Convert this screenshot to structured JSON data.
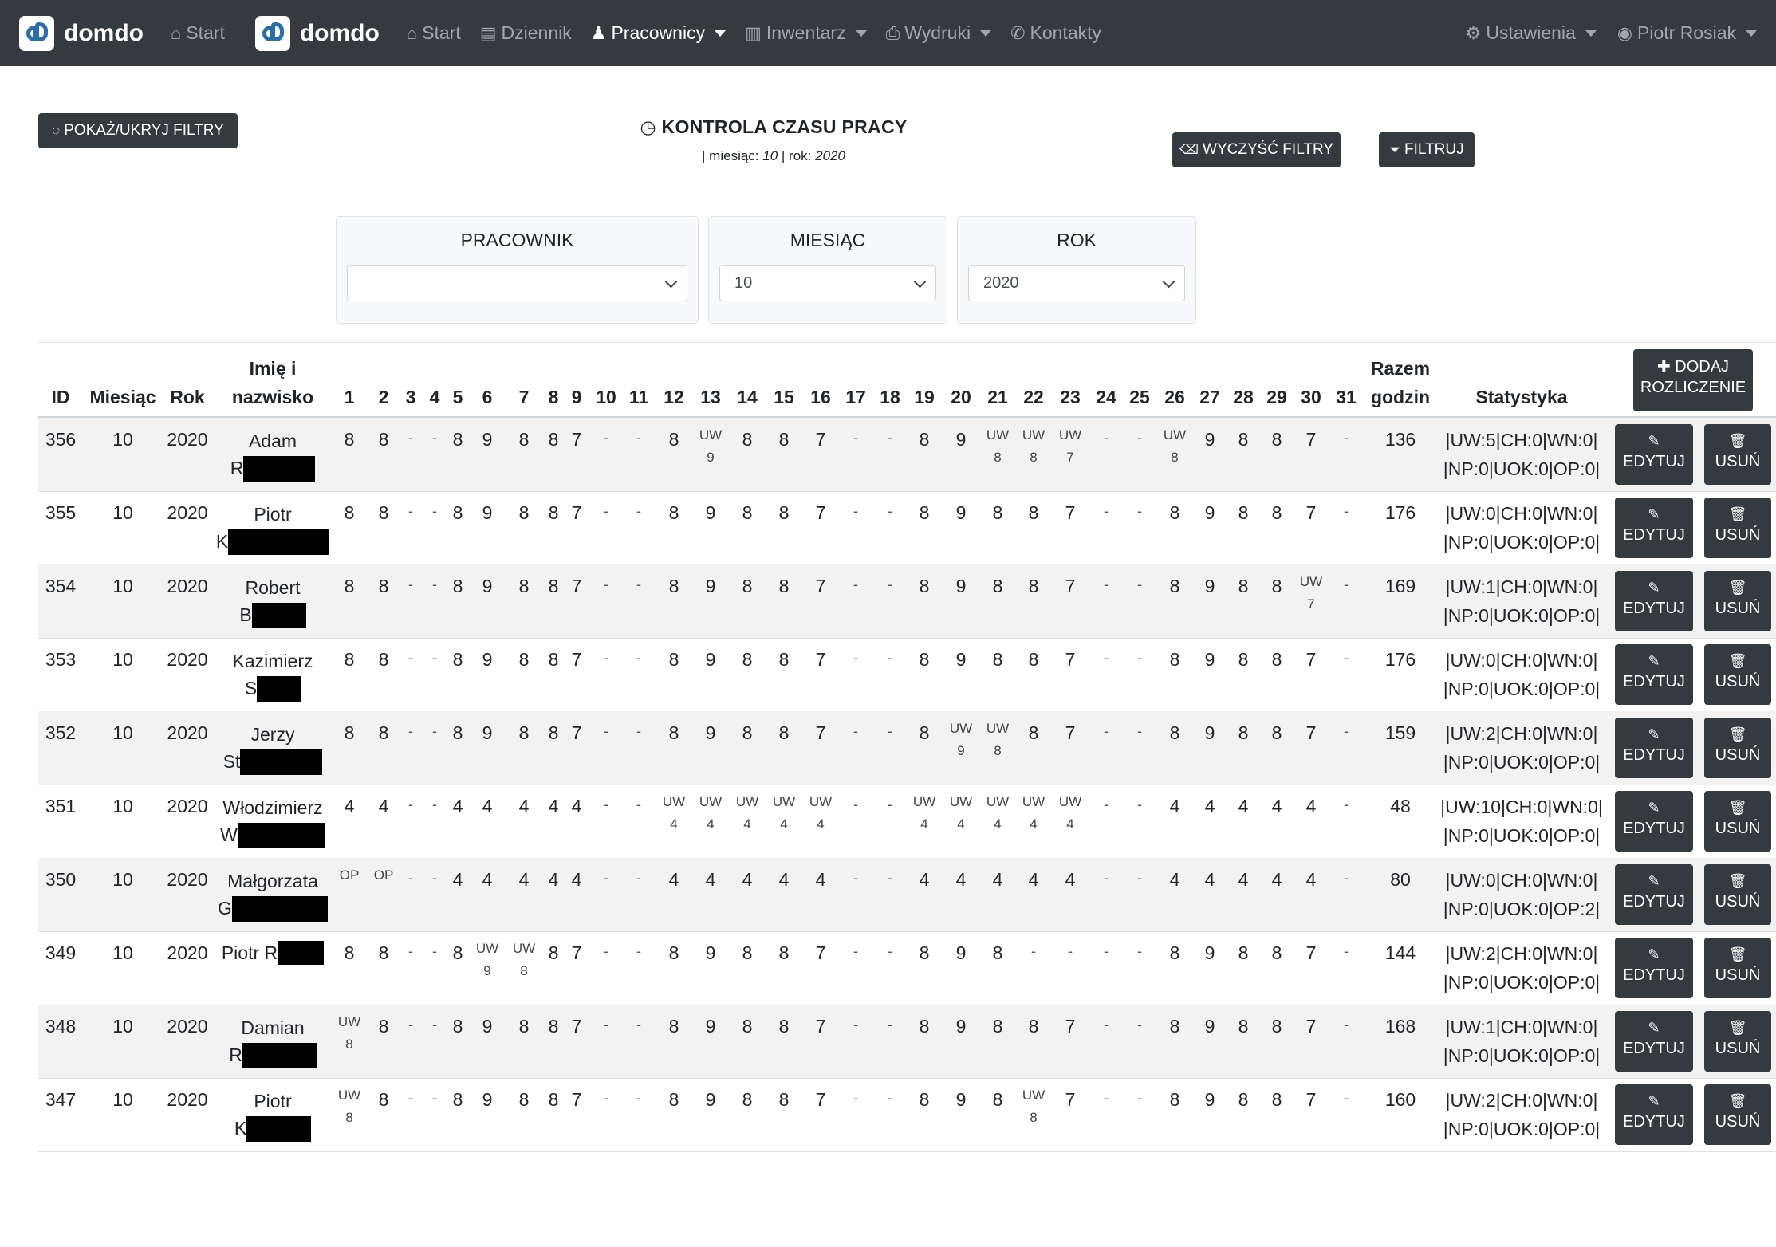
{
  "nav": {
    "brand": "domdo",
    "start": "Start",
    "dziennik": "Dziennik",
    "pracownicy": "Pracownicy",
    "inwentarz": "Inwentarz",
    "wydruki": "Wydruki",
    "kontakty": "Kontakty",
    "ustawienia": "Ustawienia",
    "user": "Piotr Rosiak"
  },
  "toolbar": {
    "toggle_filters": "POKAŻ/UKRYJ FILTRY",
    "clear_filters": "WYCZYŚĆ FILTRY",
    "filter": "FILTRUJ"
  },
  "page": {
    "title": "KONTROLA CZASU PRACY",
    "sub_prefix": "| miesiąc: ",
    "month": "10",
    "sub_mid": " | rok: ",
    "year": "2020"
  },
  "filters": {
    "employee_label": "PRACOWNIK",
    "employee_value": "",
    "month_label": "MIESIĄC",
    "month_value": "10",
    "year_label": "ROK",
    "year_value": "2020"
  },
  "table": {
    "headers": {
      "id": "ID",
      "month": "Miesiąc",
      "year": "Rok",
      "name_line1": "Imię i",
      "name_line2": "nazwisko",
      "total_line1": "Razem",
      "total_line2": "godzin",
      "stats": "Statystyka",
      "add_line1": "DODAJ",
      "add_line2": "ROZLICZENIE"
    },
    "days": [
      "1",
      "2",
      "3",
      "4",
      "5",
      "6",
      "7",
      "8",
      "9",
      "10",
      "11",
      "12",
      "13",
      "14",
      "15",
      "16",
      "17",
      "18",
      "19",
      "20",
      "21",
      "22",
      "23",
      "24",
      "25",
      "26",
      "27",
      "28",
      "29",
      "30",
      "31"
    ],
    "edit_label": "EDYTUJ",
    "delete_label": "USUŃ",
    "rows": [
      {
        "id": "356",
        "month": "10",
        "year": "2020",
        "name1": "Adam",
        "name2": "R",
        "total": "136",
        "stat1": "|UW:5|CH:0|WN:0|",
        "stat2": "|NP:0|UOK:0|OP:0|",
        "cells": [
          "8",
          "8",
          "-",
          "-",
          "8",
          "9",
          "8",
          "8",
          "7",
          "-",
          "-",
          "8",
          "UW|9",
          "8",
          "8",
          "7",
          "-",
          "-",
          "8",
          "9",
          "UW|8",
          "UW|8",
          "UW|7",
          "-",
          "-",
          "UW|8",
          "9",
          "8",
          "8",
          "7",
          "-"
        ]
      },
      {
        "id": "355",
        "month": "10",
        "year": "2020",
        "name1": "Piotr",
        "name2": "K",
        "total": "176",
        "stat1": "|UW:0|CH:0|WN:0|",
        "stat2": "|NP:0|UOK:0|OP:0|",
        "cells": [
          "8",
          "8",
          "-",
          "-",
          "8",
          "9",
          "8",
          "8",
          "7",
          "-",
          "-",
          "8",
          "9",
          "8",
          "8",
          "7",
          "-",
          "-",
          "8",
          "9",
          "8",
          "8",
          "7",
          "-",
          "-",
          "8",
          "9",
          "8",
          "8",
          "7",
          "-"
        ]
      },
      {
        "id": "354",
        "month": "10",
        "year": "2020",
        "name1": "Robert",
        "name2": "B",
        "total": "169",
        "stat1": "|UW:1|CH:0|WN:0|",
        "stat2": "|NP:0|UOK:0|OP:0|",
        "cells": [
          "8",
          "8",
          "-",
          "-",
          "8",
          "9",
          "8",
          "8",
          "7",
          "-",
          "-",
          "8",
          "9",
          "8",
          "8",
          "7",
          "-",
          "-",
          "8",
          "9",
          "8",
          "8",
          "7",
          "-",
          "-",
          "8",
          "9",
          "8",
          "8",
          "UW|7",
          "-"
        ]
      },
      {
        "id": "353",
        "month": "10",
        "year": "2020",
        "name1": "Kazimierz",
        "name2": "S",
        "total": "176",
        "stat1": "|UW:0|CH:0|WN:0|",
        "stat2": "|NP:0|UOK:0|OP:0|",
        "cells": [
          "8",
          "8",
          "-",
          "-",
          "8",
          "9",
          "8",
          "8",
          "7",
          "-",
          "-",
          "8",
          "9",
          "8",
          "8",
          "7",
          "-",
          "-",
          "8",
          "9",
          "8",
          "8",
          "7",
          "-",
          "-",
          "8",
          "9",
          "8",
          "8",
          "7",
          "-"
        ]
      },
      {
        "id": "352",
        "month": "10",
        "year": "2020",
        "name1": "Jerzy",
        "name2": "St",
        "total": "159",
        "stat1": "|UW:2|CH:0|WN:0|",
        "stat2": "|NP:0|UOK:0|OP:0|",
        "cells": [
          "8",
          "8",
          "-",
          "-",
          "8",
          "9",
          "8",
          "8",
          "7",
          "-",
          "-",
          "8",
          "9",
          "8",
          "8",
          "7",
          "-",
          "-",
          "8",
          "UW|9",
          "UW|8",
          "8",
          "7",
          "-",
          "-",
          "8",
          "9",
          "8",
          "8",
          "7",
          "-"
        ]
      },
      {
        "id": "351",
        "month": "10",
        "year": "2020",
        "name1": "Włodzimierz",
        "name2": "W",
        "total": "48",
        "stat1": "|UW:10|CH:0|WN:0|",
        "stat2": "|NP:0|UOK:0|OP:0|",
        "cells": [
          "4",
          "4",
          "-",
          "-",
          "4",
          "4",
          "4",
          "4",
          "4",
          "-",
          "-",
          "UW|4",
          "UW|4",
          "UW|4",
          "UW|4",
          "UW|4",
          "-",
          "-",
          "UW|4",
          "UW|4",
          "UW|4",
          "UW|4",
          "UW|4",
          "-",
          "-",
          "4",
          "4",
          "4",
          "4",
          "4",
          "-"
        ]
      },
      {
        "id": "350",
        "month": "10",
        "year": "2020",
        "name1": "Małgorzata",
        "name2": "G",
        "total": "80",
        "stat1": "|UW:0|CH:0|WN:0|",
        "stat2": "|NP:0|UOK:0|OP:2|",
        "cells": [
          "OP",
          "OP",
          "-",
          "-",
          "4",
          "4",
          "4",
          "4",
          "4",
          "-",
          "-",
          "4",
          "4",
          "4",
          "4",
          "4",
          "-",
          "-",
          "4",
          "4",
          "4",
          "4",
          "4",
          "-",
          "-",
          "4",
          "4",
          "4",
          "4",
          "4",
          "-"
        ]
      },
      {
        "id": "349",
        "month": "10",
        "year": "2020",
        "name1": "Piotr R",
        "name2": "",
        "total": "144",
        "stat1": "|UW:2|CH:0|WN:0|",
        "stat2": "|NP:0|UOK:0|OP:0|",
        "cells": [
          "8",
          "8",
          "-",
          "-",
          "8",
          "UW|9",
          "UW|8",
          "8",
          "7",
          "-",
          "-",
          "8",
          "9",
          "8",
          "8",
          "7",
          "-",
          "-",
          "8",
          "9",
          "8",
          "-",
          "-",
          "-",
          "-",
          "8",
          "9",
          "8",
          "8",
          "7",
          "-"
        ]
      },
      {
        "id": "348",
        "month": "10",
        "year": "2020",
        "name1": "Damian",
        "name2": "R",
        "total": "168",
        "stat1": "|UW:1|CH:0|WN:0|",
        "stat2": "|NP:0|UOK:0|OP:0|",
        "cells": [
          "UW|8",
          "8",
          "-",
          "-",
          "8",
          "9",
          "8",
          "8",
          "7",
          "-",
          "-",
          "8",
          "9",
          "8",
          "8",
          "7",
          "-",
          "-",
          "8",
          "9",
          "8",
          "8",
          "7",
          "-",
          "-",
          "8",
          "9",
          "8",
          "8",
          "7",
          "-"
        ]
      },
      {
        "id": "347",
        "month": "10",
        "year": "2020",
        "name1": "Piotr",
        "name2": "K",
        "total": "160",
        "stat1": "|UW:2|CH:0|WN:0|",
        "stat2": "|NP:0|UOK:0|OP:0|",
        "cells": [
          "UW|8",
          "8",
          "-",
          "-",
          "8",
          "9",
          "8",
          "8",
          "7",
          "-",
          "-",
          "8",
          "9",
          "8",
          "8",
          "7",
          "-",
          "-",
          "8",
          "9",
          "8",
          "UW|8",
          "7",
          "-",
          "-",
          "8",
          "9",
          "8",
          "8",
          "7",
          "-"
        ]
      }
    ]
  },
  "colors": {
    "navbar": "#343a40",
    "button": "#343a40",
    "stripe": "#f2f2f2"
  }
}
